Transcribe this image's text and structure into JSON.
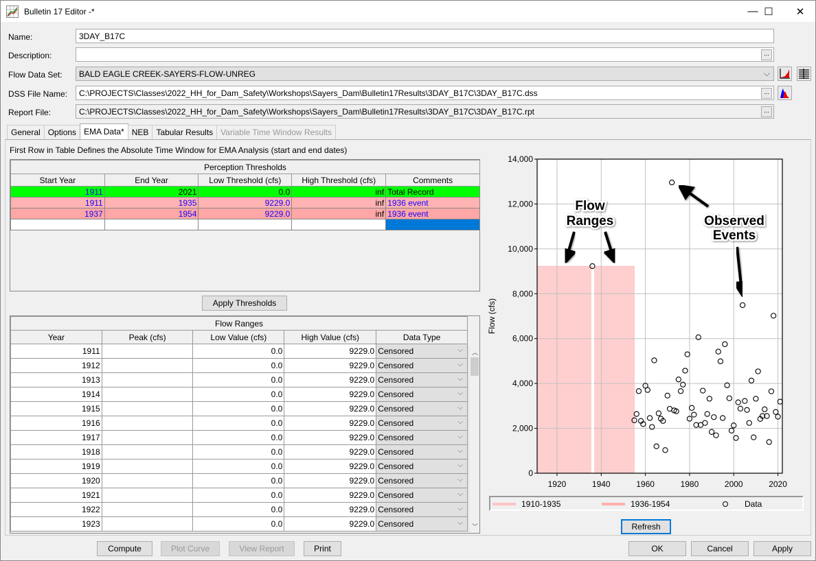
{
  "window": {
    "title": "Bulletin 17 Editor -*",
    "minimize_glyph": "—",
    "maximize_glyph": "☐",
    "close_glyph": "✕"
  },
  "form": {
    "name_label": "Name:",
    "name_value": "3DAY_B17C",
    "description_label": "Description:",
    "description_value": "",
    "flow_data_set_label": "Flow Data Set:",
    "flow_data_set_value": "BALD EAGLE CREEK-SAYERS-FLOW-UNREG",
    "dss_file_label": "DSS File Name:",
    "dss_file_value": "C:\\PROJECTS\\Classes\\2022_HH_for_Dam_Safety\\Workshops\\Sayers_Dam\\Bulletin17Results\\3DAY_B17C\\3DAY_B17C.dss",
    "report_file_label": "Report File:",
    "report_file_value": "C:\\PROJECTS\\Classes\\2022_HH_for_Dam_Safety\\Workshops\\Sayers_Dam\\Bulletin17Results\\3DAY_B17C\\3DAY_B17C.rpt",
    "browse_label": "..."
  },
  "tabs": [
    {
      "label": "General",
      "state": "normal"
    },
    {
      "label": "Options",
      "state": "normal"
    },
    {
      "label": "EMA Data*",
      "state": "active"
    },
    {
      "label": "NEB",
      "state": "normal"
    },
    {
      "label": "Tabular Results",
      "state": "normal"
    },
    {
      "label": "Variable Time Window Results",
      "state": "disabled"
    }
  ],
  "ema": {
    "note": "First Row in Table Defines the Absolute Time Window for EMA Analysis (start and end dates)",
    "perception": {
      "title": "Perception Thresholds",
      "columns": [
        "Start Year",
        "End Year",
        "Low Threshold (cfs)",
        "High Threshold (cfs)",
        "Comments"
      ],
      "rows": [
        {
          "start": "1911",
          "end": "2021",
          "low": "0.0",
          "high": "inf",
          "comment": "Total Record",
          "color": "#00ff00"
        },
        {
          "start": "1911",
          "end": "1935",
          "low": "9229.0",
          "high": "inf",
          "comment": "1936 event",
          "color": "#ffb3b3"
        },
        {
          "start": "1937",
          "end": "1954",
          "low": "9229.0",
          "high": "inf",
          "comment": "1936 event",
          "color": "#ffa6a6"
        }
      ]
    },
    "apply_thresholds_label": "Apply Thresholds",
    "flow_ranges": {
      "title": "Flow Ranges",
      "columns": [
        "Year",
        "Peak (cfs)",
        "Low Value (cfs)",
        "High Value (cfs)",
        "Data Type"
      ],
      "rows": [
        {
          "year": "1911",
          "peak": "",
          "low": "0.0",
          "high": "9229.0",
          "type": "Censored"
        },
        {
          "year": "1912",
          "peak": "",
          "low": "0.0",
          "high": "9229.0",
          "type": "Censored"
        },
        {
          "year": "1913",
          "peak": "",
          "low": "0.0",
          "high": "9229.0",
          "type": "Censored"
        },
        {
          "year": "1914",
          "peak": "",
          "low": "0.0",
          "high": "9229.0",
          "type": "Censored"
        },
        {
          "year": "1915",
          "peak": "",
          "low": "0.0",
          "high": "9229.0",
          "type": "Censored"
        },
        {
          "year": "1916",
          "peak": "",
          "low": "0.0",
          "high": "9229.0",
          "type": "Censored"
        },
        {
          "year": "1917",
          "peak": "",
          "low": "0.0",
          "high": "9229.0",
          "type": "Censored"
        },
        {
          "year": "1918",
          "peak": "",
          "low": "0.0",
          "high": "9229.0",
          "type": "Censored"
        },
        {
          "year": "1919",
          "peak": "",
          "low": "0.0",
          "high": "9229.0",
          "type": "Censored"
        },
        {
          "year": "1920",
          "peak": "",
          "low": "0.0",
          "high": "9229.0",
          "type": "Censored"
        },
        {
          "year": "1921",
          "peak": "",
          "low": "0.0",
          "high": "9229.0",
          "type": "Censored"
        },
        {
          "year": "1922",
          "peak": "",
          "low": "0.0",
          "high": "9229.0",
          "type": "Censored"
        },
        {
          "year": "1923",
          "peak": "",
          "low": "0.0",
          "high": "9229.0",
          "type": "Censored"
        }
      ]
    }
  },
  "chart_data": {
    "type": "scatter",
    "title": "",
    "xlabel": "",
    "ylabel": "Flow (cfs)",
    "xlim": [
      1911,
      2022
    ],
    "ylim": [
      0,
      14000
    ],
    "grid": true,
    "x_ticks": [
      1920,
      1940,
      1960,
      1980,
      2000,
      2020
    ],
    "y_ticks": [
      0,
      2000,
      4000,
      6000,
      8000,
      10000,
      12000,
      14000
    ],
    "y_tick_labels": [
      "0",
      "2,000",
      "4,000",
      "6,000",
      "8,000",
      "10,000",
      "12,000",
      "14,000"
    ],
    "ranges": [
      {
        "name": "1910-1935",
        "x_start": 1911,
        "x_end": 1935,
        "low": 0,
        "high": 9229,
        "color": "#ffcfcf"
      },
      {
        "name": "1936-1954",
        "x_start": 1937,
        "x_end": 1954,
        "low": 0,
        "high": 9229,
        "color": "#ffcfcf"
      }
    ],
    "series": [
      {
        "name": "Data",
        "x": [
          1936,
          1955,
          1956,
          1957,
          1958,
          1959,
          1960,
          1961,
          1962,
          1963,
          1964,
          1965,
          1966,
          1967,
          1968,
          1969,
          1970,
          1971,
          1972,
          1973,
          1974,
          1975,
          1976,
          1977,
          1978,
          1979,
          1980,
          1981,
          1982,
          1983,
          1984,
          1985,
          1986,
          1987,
          1988,
          1989,
          1990,
          1991,
          1992,
          1993,
          1994,
          1995,
          1996,
          1997,
          1998,
          1999,
          2000,
          2001,
          2002,
          2003,
          2004,
          2005,
          2006,
          2007,
          2008,
          2009,
          2010,
          2011,
          2012,
          2013,
          2014,
          2015,
          2016,
          2017,
          2018,
          2019,
          2020,
          2021
        ],
        "y": [
          9229,
          2360,
          2640,
          3660,
          2330,
          2190,
          3900,
          3710,
          2460,
          2060,
          5030,
          1200,
          2670,
          2430,
          2330,
          1030,
          3460,
          2870,
          12960,
          2800,
          2760,
          4180,
          3660,
          3950,
          4570,
          5300,
          2430,
          2910,
          2610,
          2150,
          6060,
          2150,
          3680,
          2240,
          2640,
          3320,
          1840,
          2500,
          1690,
          5420,
          4990,
          2460,
          5750,
          3920,
          3340,
          1900,
          2130,
          1570,
          3160,
          2880,
          7490,
          3220,
          2820,
          2240,
          4130,
          1600,
          3320,
          4540,
          2420,
          2550,
          2850,
          2550,
          1390,
          3650,
          7020,
          2730,
          2520,
          3190
        ]
      }
    ],
    "legend": [
      "1910-1935",
      "1936-1954",
      "Data"
    ],
    "legend_position": "bottom",
    "annotations": [
      {
        "text_lines": [
          "Flow",
          "Ranges"
        ],
        "points_to": "flow ranges"
      },
      {
        "text_lines": [
          "Observed",
          "Events"
        ],
        "points_to": "observed events"
      }
    ]
  },
  "chart_buttons": {
    "refresh_label": "Refresh"
  },
  "footer": {
    "compute_label": "Compute",
    "plot_curve_label": "Plot Curve",
    "view_report_label": "View Report",
    "print_label": "Print",
    "ok_label": "OK",
    "cancel_label": "Cancel",
    "apply_label": "Apply"
  }
}
